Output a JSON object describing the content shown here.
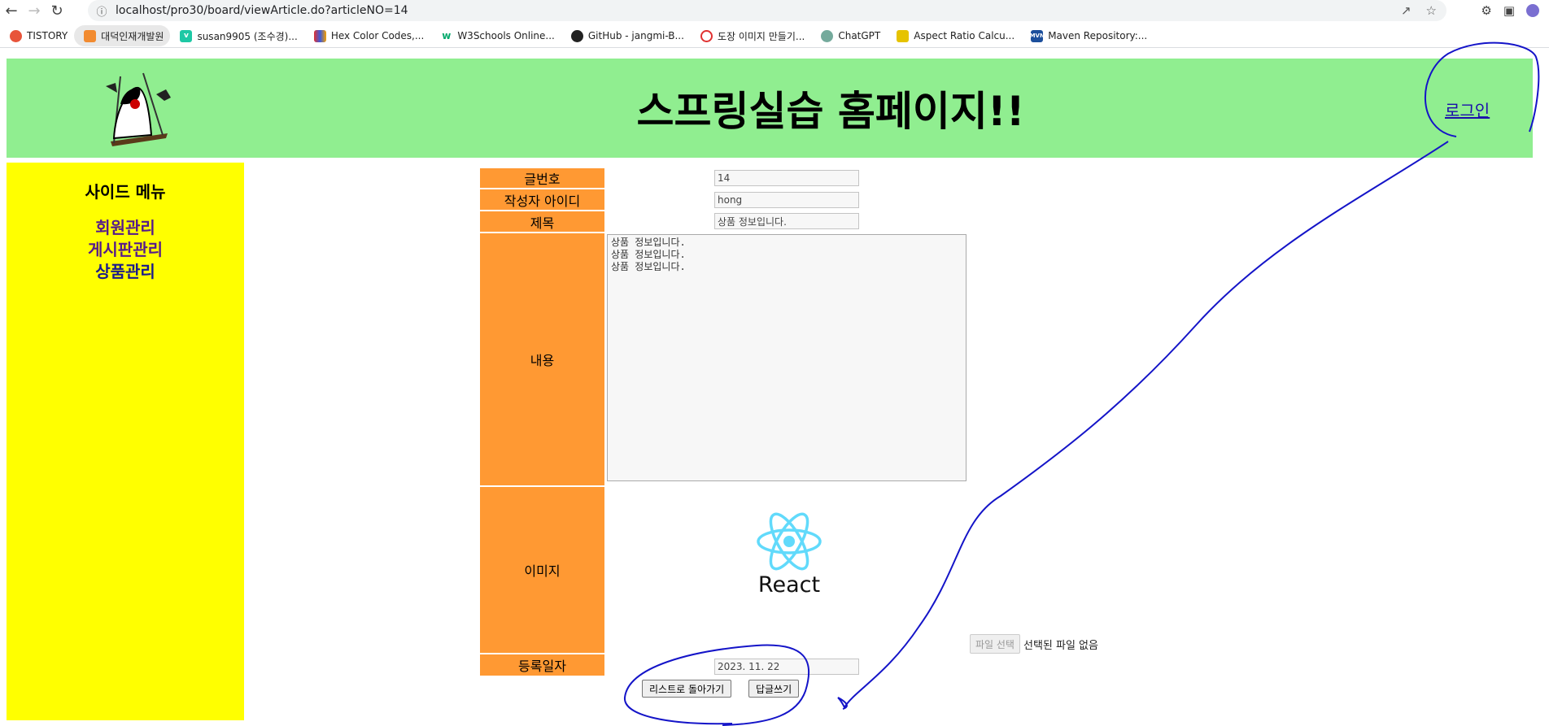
{
  "browser": {
    "url": "localhost/pro30/board/viewArticle.do?articleNO=14",
    "bookmarks": [
      {
        "label": "TISTORY",
        "color": "#e8543a"
      },
      {
        "label": "대덕인재개발원",
        "color": "#f28b30"
      },
      {
        "label": "susan9905 (조수경)...",
        "color": "#1ec8a5"
      },
      {
        "label": "Hex Color Codes,...",
        "color": "#3b5bdb"
      },
      {
        "label": "W3Schools Online...",
        "color": "#04aa6d"
      },
      {
        "label": "GitHub - jangmi-B...",
        "color": "#222222"
      },
      {
        "label": "도장 이미지 만들기...",
        "color": "#e03131"
      },
      {
        "label": "ChatGPT",
        "color": "#74aa9c"
      },
      {
        "label": "Aspect Ratio Calcu...",
        "color": "#e6c300"
      },
      {
        "label": "Maven Repository:...",
        "color": "#1c4f9c"
      }
    ]
  },
  "header": {
    "title": "스프링실습 홈페이지!!",
    "login": "로그인"
  },
  "sidebar": {
    "title": "사이드 메뉴",
    "links": [
      "회원관리",
      "게시판관리",
      "상품관리"
    ]
  },
  "form": {
    "labels": {
      "article_no": "글번호",
      "writer_id": "작성자 아이디",
      "title": "제목",
      "content": "내용",
      "image": "이미지",
      "date": "등록일자"
    },
    "values": {
      "article_no": "14",
      "writer_id": "hong",
      "title": "상품 정보입니다.",
      "content": "상품 정보입니다.\n상품 정보입니다.\n상품 정보입니다.",
      "date": "2023. 11. 22"
    },
    "image_caption": "React",
    "file_button": "파일 선택",
    "file_status": "선택된 파일 없음",
    "buttons": {
      "back": "리스트로 돌아가기",
      "reply": "답글쓰기"
    }
  },
  "colors": {
    "header_bg": "#90ee90",
    "sidebar_bg": "#ffff00",
    "label_bg": "#ff9933",
    "annotation": "#0000cc",
    "react": "#61dafb"
  }
}
